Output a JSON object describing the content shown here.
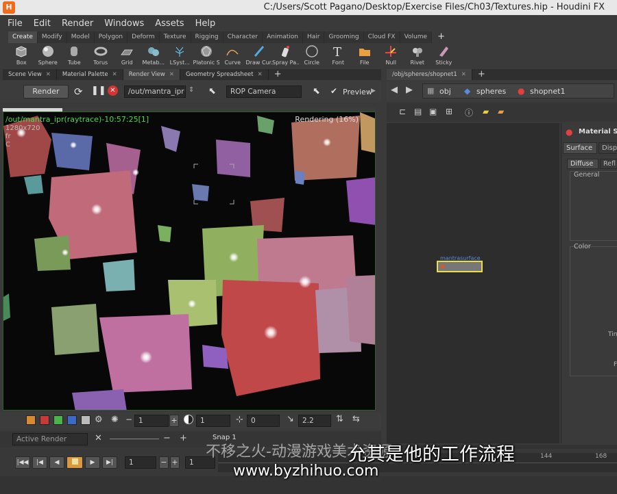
{
  "window": {
    "title": "C:/Users/Scott Pagano/Desktop/Exercise Files/Ch03/Textures.hip - Houdini FX",
    "logo": "H"
  },
  "menu": [
    "File",
    "Edit",
    "Render",
    "Windows",
    "Assets",
    "Help"
  ],
  "shelf_tabs": [
    "Create",
    "Modify",
    "Model",
    "Polygon",
    "Deform",
    "Texture",
    "Rigging",
    "Character",
    "Animation",
    "Hair",
    "Grooming",
    "Cloud FX",
    "Volume"
  ],
  "shelf_tools": [
    {
      "label": "Box",
      "icon": "box-icon"
    },
    {
      "label": "Sphere",
      "icon": "sphere-icon"
    },
    {
      "label": "Tube",
      "icon": "tube-icon"
    },
    {
      "label": "Torus",
      "icon": "torus-icon"
    },
    {
      "label": "Grid",
      "icon": "grid-icon"
    },
    {
      "label": "Metab...",
      "icon": "metaball-icon"
    },
    {
      "label": "LSyst...",
      "icon": "lsystem-icon"
    },
    {
      "label": "Platonic Sol...",
      "icon": "platonic-icon"
    },
    {
      "label": "Curve",
      "icon": "curve-icon"
    },
    {
      "label": "Draw Cur...",
      "icon": "draw-curve-icon"
    },
    {
      "label": "Spray Pa...",
      "icon": "spray-paint-icon"
    },
    {
      "label": "Circle",
      "icon": "circle-icon"
    },
    {
      "label": "Font",
      "icon": "font-icon"
    },
    {
      "label": "File",
      "icon": "file-icon"
    },
    {
      "label": "Null",
      "icon": "null-icon"
    },
    {
      "label": "Rivet",
      "icon": "rivet-icon"
    },
    {
      "label": "Sticky",
      "icon": "sticky-icon"
    }
  ],
  "left_tabs": [
    "Scene View",
    "Material Palette",
    "Render View",
    "Geometry Spreadsheet"
  ],
  "right_path": "/obj/spheres/shopnet1",
  "render_toolbar": {
    "render_label": "Render",
    "rop_path": "/out/mantra_ipr",
    "camera": "ROP Camera",
    "preview_label": "Preview"
  },
  "viewport": {
    "overlay_title": "/out/mantra_ipr(raytrace)-10:57:25[1]",
    "resolution": "1280x720",
    "line2": "fr",
    "line3": "C",
    "status": "Rendering (16%)"
  },
  "bottom_controls": {
    "field1": "1",
    "field2": "1",
    "field3": "0",
    "field4": "2.2"
  },
  "left_lower": {
    "label": "Active Render",
    "snap": "Snap 1"
  },
  "timeline": {
    "frame": "1",
    "frame2": "1",
    "tick1": "144",
    "tick2": "168"
  },
  "network": {
    "crumbs": [
      "obj",
      "spheres",
      "shopnet1"
    ],
    "node_label": "mantrasurface"
  },
  "params": {
    "header": "Material S",
    "tab1": "Surface",
    "tab2": "Disp",
    "subtab1": "Diffuse",
    "subtab2": "Refl",
    "group1": "General",
    "group2": "Color",
    "t1": "Tin",
    "t2": "F"
  },
  "overlay_text": {
    "subtitle": "允其是他的工作流程",
    "watermark1": "不移之火-动漫游戏美术资源",
    "watermark2": "www.byzhihuo.com"
  },
  "colors": {
    "accent": "#f06b1c",
    "render_green": "#4cd84c",
    "node_yellow": "#e8e04a"
  }
}
